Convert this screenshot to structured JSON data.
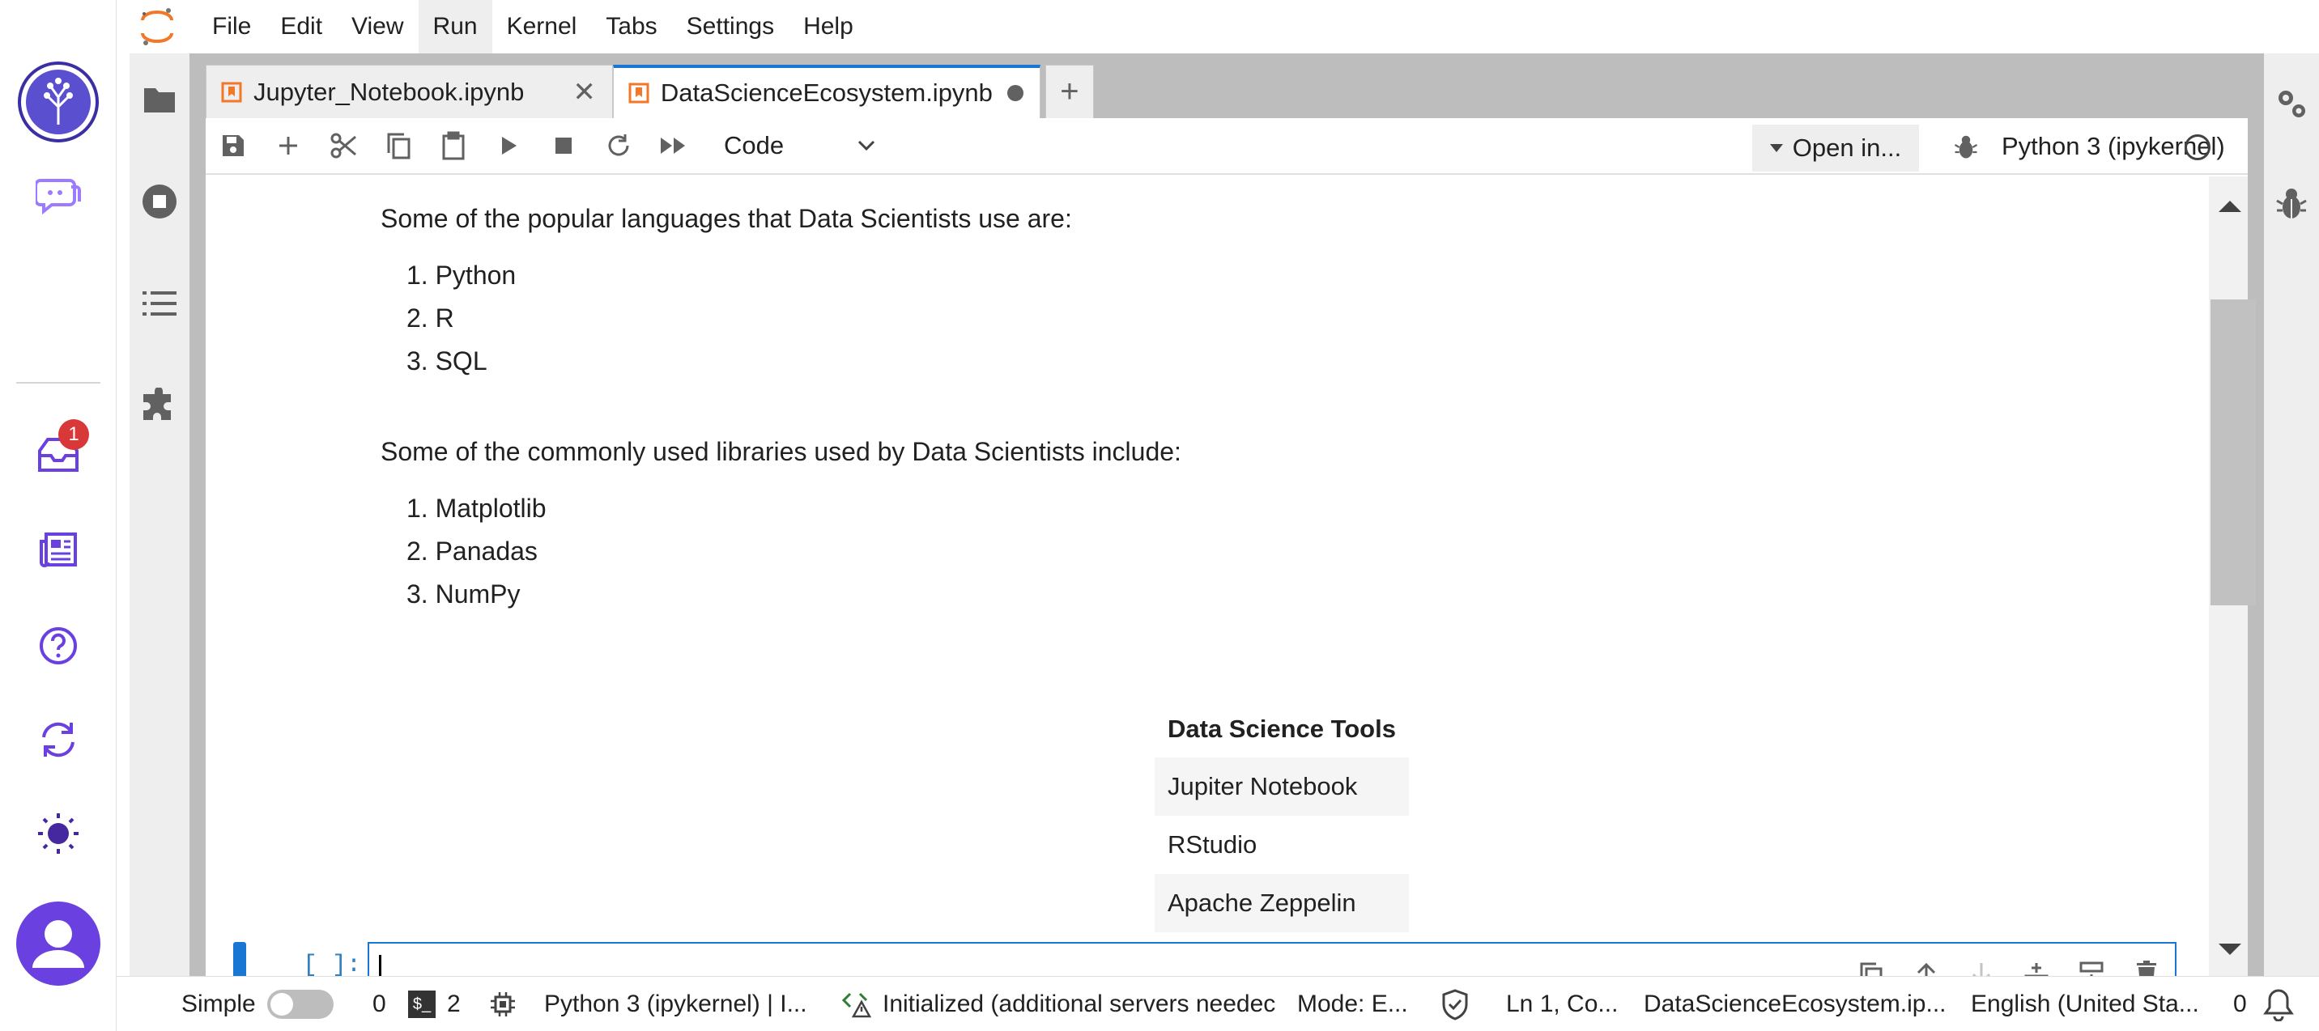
{
  "menu": {
    "items": [
      "File",
      "Edit",
      "View",
      "Run",
      "Kernel",
      "Tabs",
      "Settings",
      "Help"
    ],
    "active_index": 3
  },
  "appbar": {
    "notification_count": "1"
  },
  "tabs": [
    {
      "label": "Jupyter_Notebook.ipynb",
      "current": false,
      "close": "✕"
    },
    {
      "label": "DataScienceEcosystem.ipynb",
      "current": true,
      "dirty": true
    }
  ],
  "add_tab_label": "+",
  "toolbar": {
    "cell_type": "Code",
    "open_in_label": "Open in...",
    "kernel_name": "Python 3 (ipykernel)"
  },
  "notebook": {
    "languages_intro": "Some of the popular languages that Data Scientists use are:",
    "languages": [
      "1. Python",
      "2. R",
      "3. SQL"
    ],
    "libraries_intro": "Some of the commonly used libraries used by Data Scientists include:",
    "libraries": [
      "1. Matplotlib",
      "2. Panadas",
      "3. NumPy"
    ],
    "tools_table": {
      "header": "Data Science Tools",
      "rows": [
        "Jupiter Notebook",
        "RStudio",
        "Apache Zeppelin"
      ]
    },
    "code_cell_prompt": "[ ]:"
  },
  "statusbar": {
    "mode_toggle_label": "Simple",
    "zero_count": "0",
    "terminal_icon_text": "$_",
    "terminal_count": "2",
    "kernel_status": "Python 3 (ipykernel) | I...",
    "lsp_status": "Initialized (additional servers needec",
    "mode": "Mode: E...",
    "cursor_position": "Ln 1, Co...",
    "file_name": "DataScienceEcosystem.ip...",
    "language": "English (United Sta...",
    "notifications": "0"
  },
  "colors": {
    "accent": "#1976d2",
    "appbar_icon": "#7c4dff",
    "jupyter_orange": "#f37726",
    "badge": "#d93838"
  }
}
